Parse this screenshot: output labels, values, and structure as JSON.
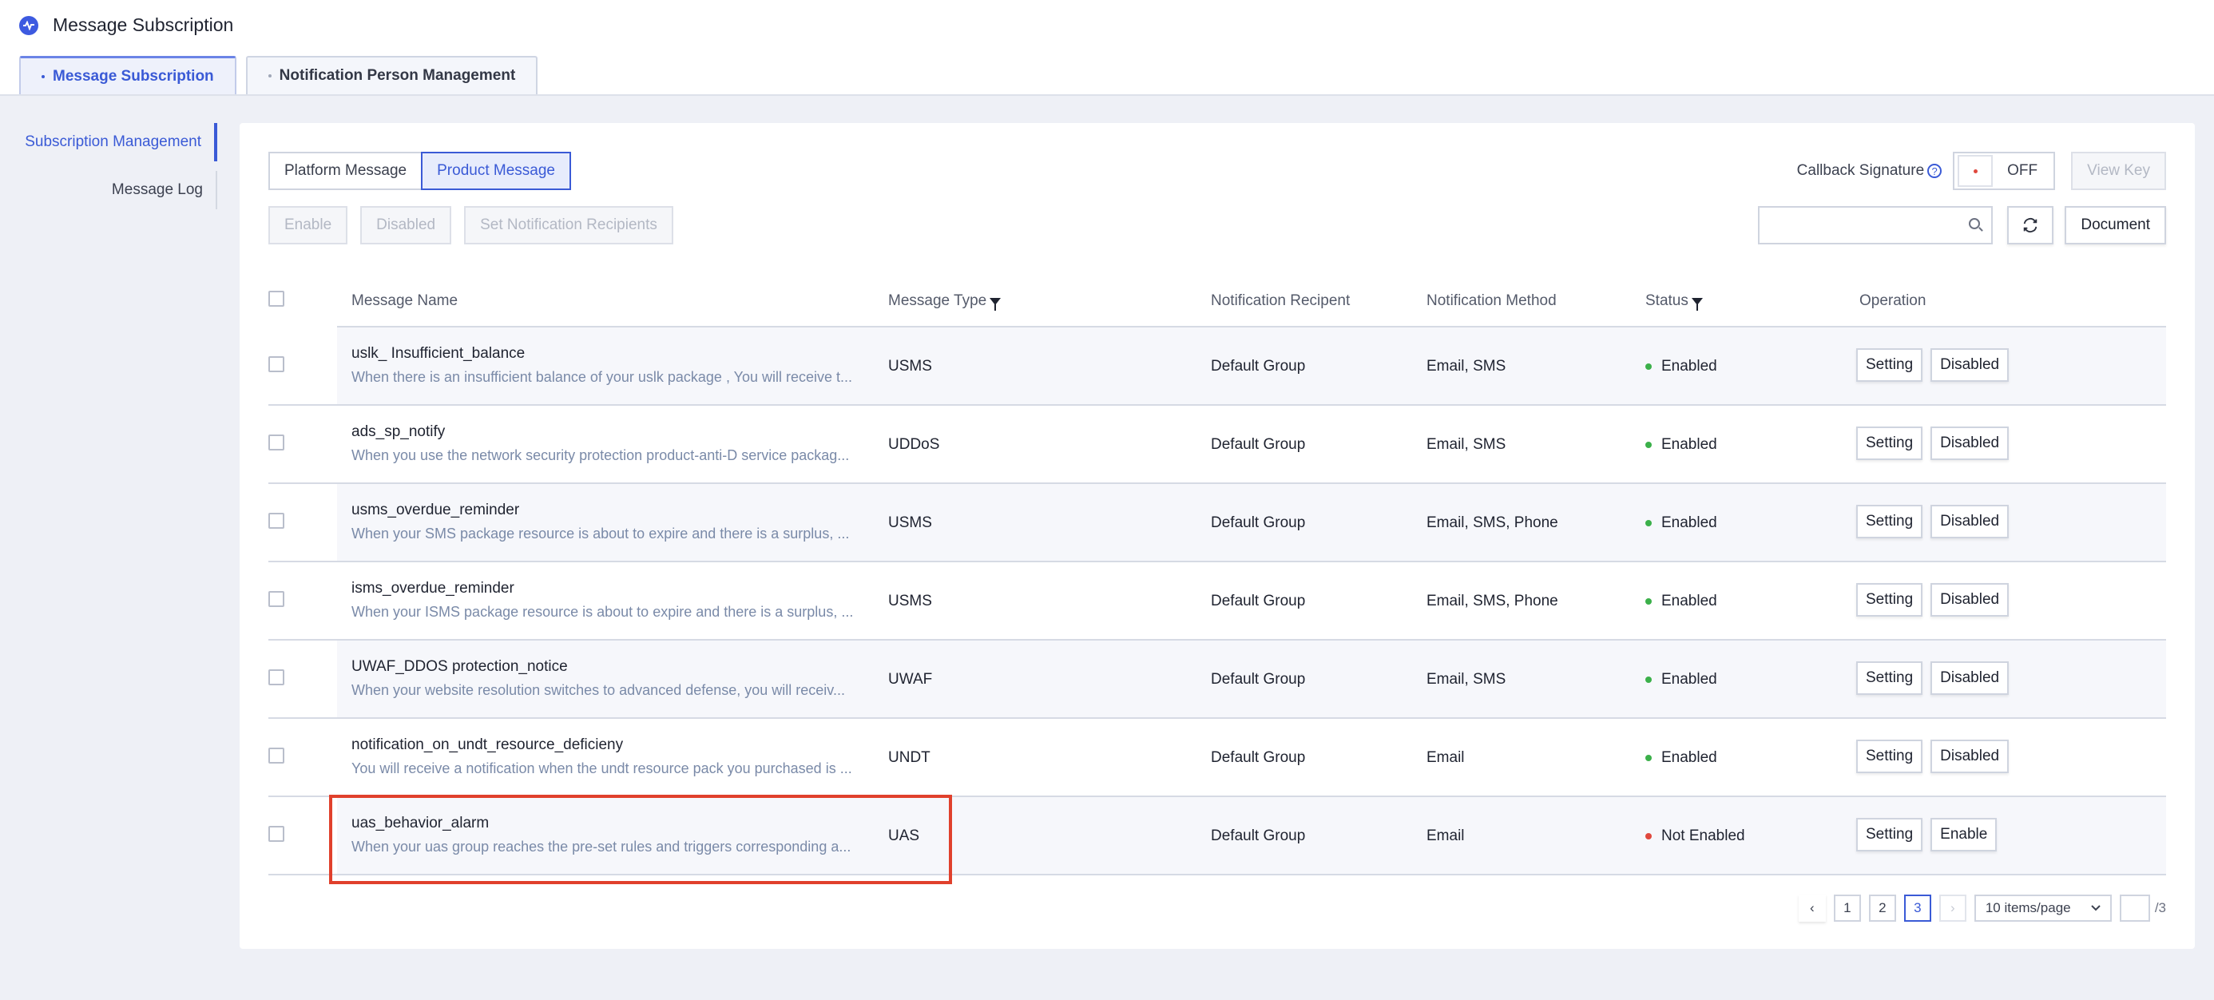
{
  "app": {
    "title": "Message Subscription"
  },
  "tabs": [
    {
      "label": "Message Subscription",
      "active": true
    },
    {
      "label": "Notification Person Management",
      "active": false
    }
  ],
  "sidebar": {
    "items": [
      {
        "label": "Subscription Management",
        "active": true
      },
      {
        "label": "Message Log",
        "active": false
      }
    ]
  },
  "segment": {
    "platform": "Platform Message",
    "product": "Product Message"
  },
  "actions": {
    "enable": "Enable",
    "disabled": "Disabled",
    "set_recipients": "Set Notification Recipients"
  },
  "callback": {
    "label": "Callback Signature",
    "toggle_state": "OFF",
    "view_key": "View Key",
    "help_icon": "?"
  },
  "toolbar": {
    "search_placeholder": "",
    "document": "Document"
  },
  "table": {
    "columns": {
      "name": "Message Name",
      "type": "Message Type",
      "recipient": "Notification Recipent",
      "method": "Notification Method",
      "status": "Status",
      "operation": "Operation"
    },
    "rows": [
      {
        "name": "uslk_ Insufficient_balance",
        "desc": "When there is an insufficient balance of your uslk package , You will receive t...",
        "type": "USMS",
        "recipient": "Default Group",
        "method": "Email, SMS",
        "status": "Enabled",
        "op_setting": "Setting",
        "op_toggle": "Disabled"
      },
      {
        "name": "ads_sp_notify",
        "desc": "When you use the network security protection product-anti-D service packag...",
        "type": "UDDoS",
        "recipient": "Default Group",
        "method": "Email, SMS",
        "status": "Enabled",
        "op_setting": "Setting",
        "op_toggle": "Disabled"
      },
      {
        "name": "usms_overdue_reminder",
        "desc": "When your SMS package resource is about to expire and there is a surplus, ...",
        "type": "USMS",
        "recipient": "Default Group",
        "method": "Email, SMS, Phone",
        "status": "Enabled",
        "op_setting": "Setting",
        "op_toggle": "Disabled"
      },
      {
        "name": "isms_overdue_reminder",
        "desc": "When your ISMS package resource is about to expire and there is a surplus, ...",
        "type": "USMS",
        "recipient": "Default Group",
        "method": "Email, SMS, Phone",
        "status": "Enabled",
        "op_setting": "Setting",
        "op_toggle": "Disabled"
      },
      {
        "name": "UWAF_DDOS protection_notice",
        "desc": "When your website resolution switches to advanced defense, you will receiv...",
        "type": "UWAF",
        "recipient": "Default Group",
        "method": "Email, SMS",
        "status": "Enabled",
        "op_setting": "Setting",
        "op_toggle": "Disabled"
      },
      {
        "name": "notification_on_undt_resource_deficieny",
        "desc": "You will receive a notification when the undt resource pack you purchased is ...",
        "type": "UNDT",
        "recipient": "Default Group",
        "method": "Email",
        "status": "Enabled",
        "op_setting": "Setting",
        "op_toggle": "Disabled"
      },
      {
        "name": "uas_behavior_alarm",
        "desc": "When your uas group reaches the pre-set rules and triggers corresponding a...",
        "type": "UAS",
        "recipient": "Default Group",
        "method": "Email",
        "status": "Not Enabled",
        "op_setting": "Setting",
        "op_toggle": "Enable"
      }
    ]
  },
  "pagination": {
    "prev": "‹",
    "next": "›",
    "pages": [
      "1",
      "2",
      "3"
    ],
    "current": "3",
    "page_size": "10 items/page",
    "total": "/3"
  },
  "colors": {
    "accent": "#3a5ad6",
    "enabled": "#3bb04a",
    "not_enabled": "#e0483d",
    "highlight": "#e0402c"
  }
}
